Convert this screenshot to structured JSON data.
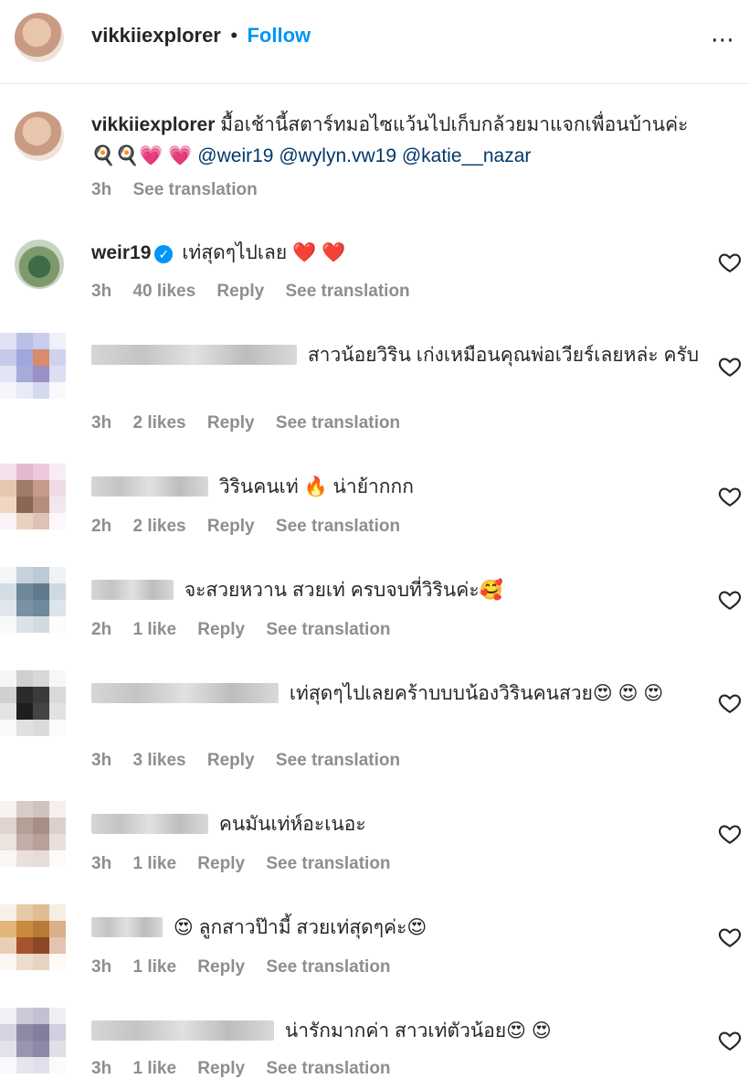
{
  "header": {
    "username": "vikkiiexplorer",
    "separator": "•",
    "follow_label": "Follow",
    "more_icon": "⋯"
  },
  "caption": {
    "username": "vikkiiexplorer",
    "text": "มื้อเช้านี้สตาร์ทมอไซแว้นไปเก็บกล้วยมาแจกเพื่อนบ้านค่ะ",
    "emojis": "🍳🍳💗 💗",
    "mentions": [
      "@weir19",
      "@wylyn.vw19",
      "@katie__nazar"
    ],
    "time": "3h",
    "see_translation": "See translation"
  },
  "comments": [
    {
      "username": "weir19",
      "verified": true,
      "text": "เท่สุดๆไปเลย",
      "emojis": "❤️ ❤️",
      "time": "3h",
      "likes": "40 likes",
      "reply": "Reply",
      "see_translation": "See translation"
    },
    {
      "username": "",
      "text": "สาวน้อยวิริน เก่งเหมือนคุณพ่อเวียร์เลยหล่ะ ครับ",
      "emojis": "",
      "time": "3h",
      "likes": "2 likes",
      "reply": "Reply",
      "see_translation": "See translation"
    },
    {
      "username": "",
      "text": "วิรินคนเท่",
      "emojis": "🔥",
      "text2": "น่าย้ากกก",
      "time": "2h",
      "likes": "2 likes",
      "reply": "Reply",
      "see_translation": "See translation"
    },
    {
      "username": "",
      "text": "จะสวยหวาน สวยเท่ ครบจบที่วิรินค่ะ",
      "emojis": "🥰",
      "time": "2h",
      "likes": "1 like",
      "reply": "Reply",
      "see_translation": "See translation"
    },
    {
      "username": "",
      "text": "เท่สุดๆไปเลยคร้าบบบน้องวิรินคนสวย",
      "emojis": "😍 😍 😍",
      "time": "3h",
      "likes": "3 likes",
      "reply": "Reply",
      "see_translation": "See translation"
    },
    {
      "username": "",
      "text": "คนมันเท่ห์อะเนอะ",
      "emojis": "",
      "time": "3h",
      "likes": "1 like",
      "reply": "Reply",
      "see_translation": "See translation"
    },
    {
      "username": "",
      "text": "ลูกสาวป๊ามี้ สวยเท่สุดๆค่ะ",
      "emojis": "😍",
      "lead_emoji": "😍",
      "time": "3h",
      "likes": "1 like",
      "reply": "Reply",
      "see_translation": "See translation"
    },
    {
      "username": "",
      "text": "น่ารักมากค่า สาวเท่ตัวน้อย",
      "emojis": "😍 😍",
      "time": "3h",
      "likes": "1 like",
      "reply": "Reply",
      "see_translation": "See translation"
    }
  ],
  "icons": {
    "heart": "heart-outline-icon",
    "verified": "verified-badge-icon"
  }
}
